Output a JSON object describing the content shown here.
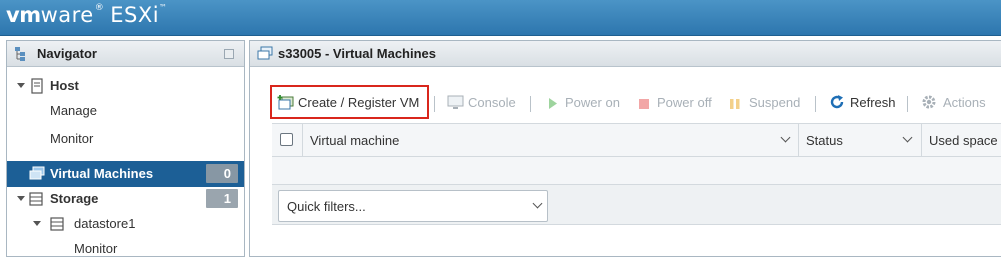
{
  "brand": {
    "vm": "vm",
    "ware": "ware",
    "product": "ESXi"
  },
  "navigator": {
    "title": "Navigator",
    "items": [
      {
        "label": "Host"
      },
      {
        "label": "Manage"
      },
      {
        "label": "Monitor"
      },
      {
        "label": "Virtual Machines",
        "badge": "0",
        "selected": true
      },
      {
        "label": "Storage",
        "badge": "1"
      },
      {
        "label": "datastore1"
      },
      {
        "label": "Monitor"
      }
    ]
  },
  "main": {
    "title": "s33005 - Virtual Machines",
    "toolbar": {
      "create_register": "Create / Register VM",
      "console": "Console",
      "power_on": "Power on",
      "power_off": "Power off",
      "suspend": "Suspend",
      "refresh": "Refresh",
      "actions": "Actions"
    },
    "columns": [
      "Virtual machine",
      "Status",
      "Used space"
    ],
    "quick_filters": "Quick filters..."
  },
  "colors": {
    "banner": "#2d76ae",
    "selected": "#1c5f96",
    "highlight": "#d9261c",
    "disabled": "#a8b0b7"
  }
}
